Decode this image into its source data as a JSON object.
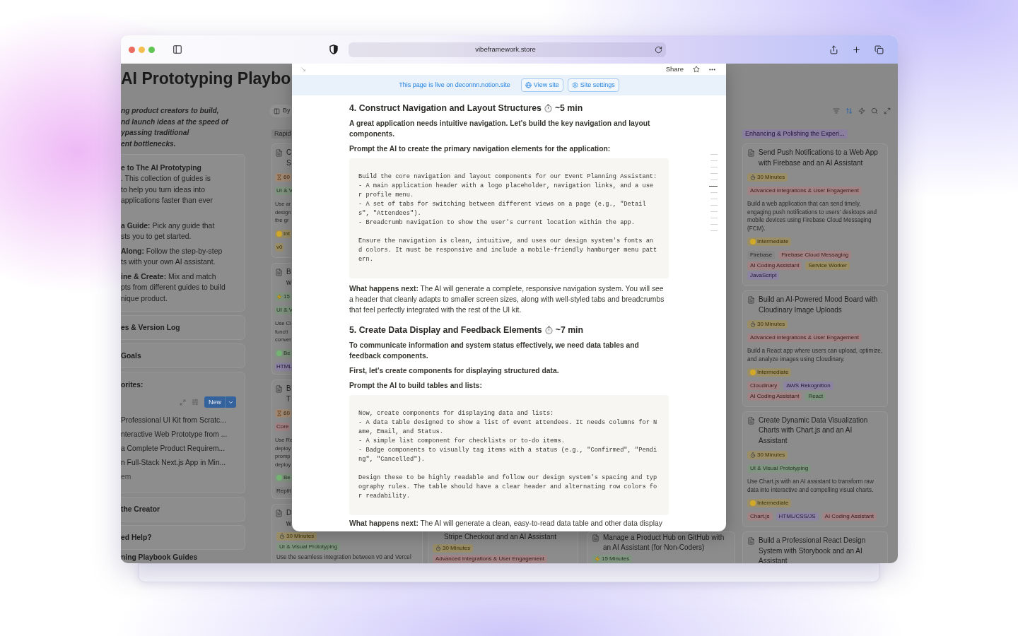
{
  "browser": {
    "address": "vibeframework.store"
  },
  "page": {
    "title": "AI Prototyping Playbo",
    "tagline": "ng product creators to build,\nnd launch ideas at the speed of\nypassing traditional\nent bottlenecks."
  },
  "sidebar": [
    {
      "kind": "callout",
      "paragraphs": [
        "**e to The AI Prototyping**\n. This collection of guides is\nto help you turn ideas into\napplications faster than ever",
        "**a Guide:** Pick any guide that\nsts you to get started.",
        "**Along:** Follow the step-by-step\nts with your own AI assistant.",
        "**ine & Create:** Mix and match\npts from different guides to build\nnique product."
      ]
    },
    {
      "kind": "toggle",
      "label": "es & Version Log"
    },
    {
      "kind": "toggle",
      "label": "Goals"
    },
    {
      "kind": "list",
      "label": "orites:",
      "button": "New",
      "items": [
        "Professional UI Kit from Scratc...",
        "nteractive Web Prototype from ...",
        "a Complete Product Requirem...",
        "n Full-Stack Next.js App in Min..."
      ],
      "add": "em"
    },
    {
      "kind": "toggle",
      "label": "the Creator"
    },
    {
      "kind": "toggle",
      "label": "ed Help?"
    },
    {
      "kind": "heading",
      "label": "ning Playbook Guides"
    }
  ],
  "board": {
    "view_button": "By",
    "tools": [
      {
        "kind": "filter",
        "on": false
      },
      {
        "kind": "sort",
        "on": true
      },
      {
        "kind": "automation",
        "on": false
      },
      {
        "kind": "search",
        "on": false
      },
      {
        "kind": "expand",
        "on": false
      }
    ],
    "columns": [
      {
        "kind": "strip",
        "group": {
          "label": "Rapid",
          "color": "#7f7f7f"
        },
        "cards": [
          {
            "kind": "card",
            "title": "C\nS",
            "rows": [
              {
                "kind": "tags",
                "tags": [
                  {
                    "label": "60",
                    "kind": "hourglass",
                    "color": "#a08a76"
                  }
                ]
              },
              {
                "kind": "tags",
                "tags": [
                  {
                    "label": "UI & V",
                    "kind": "plain",
                    "color": "#819381"
                  }
                ]
              },
              {
                "kind": "text",
                "text": "Use ar\ndesign\nthe gr"
              },
              {
                "kind": "tags",
                "tags": [
                  {
                    "label": "Int",
                    "kind": "dot",
                    "color": "#9a8e69"
                  }
                ]
              },
              {
                "kind": "tags",
                "tags": [
                  {
                    "label": "v0",
                    "kind": "plain",
                    "color": "#9a8e69"
                  }
                ]
              }
            ]
          },
          {
            "kind": "card",
            "title": "B\nw",
            "rows": [
              {
                "kind": "tags",
                "tags": [
                  {
                    "label": "15",
                    "kind": "bolt",
                    "color": "#819381"
                  }
                ]
              },
              {
                "kind": "tags",
                "tags": [
                  {
                    "label": "UI & V",
                    "kind": "plain",
                    "color": "#819381"
                  }
                ]
              },
              {
                "kind": "text",
                "text": "Use Cl\nfuncti\nconver"
              },
              {
                "kind": "tags",
                "tags": [
                  {
                    "label": "Be",
                    "kind": "dot",
                    "color": "#819381"
                  }
                ]
              },
              {
                "kind": "tags",
                "tags": [
                  {
                    "label": "HTML",
                    "kind": "plain",
                    "color": "#8d84a1"
                  }
                ]
              }
            ]
          },
          {
            "kind": "card",
            "title": "B\nT",
            "rows": [
              {
                "kind": "tags",
                "tags": [
                  {
                    "label": "60",
                    "kind": "hourglass",
                    "color": "#a08a76"
                  }
                ]
              },
              {
                "kind": "tags",
                "tags": [
                  {
                    "label": "Core",
                    "kind": "plain",
                    "color": "#a08384"
                  }
                ]
              },
              {
                "kind": "text",
                "text": "Use Re\ndeploy\npromp\ndeploy"
              },
              {
                "kind": "tags",
                "tags": [
                  {
                    "label": "Be",
                    "kind": "dot",
                    "color": "#819381"
                  }
                ]
              },
              {
                "kind": "tags",
                "tags": [
                  {
                    "label": "Replit",
                    "kind": "plain",
                    "color": "#868686"
                  }
                ]
              }
            ]
          },
          {
            "kind": "card",
            "title": "D\nw"
          }
        ],
        "continued": {
          "kind": "continued",
          "rows": [
            {
              "kind": "tags",
              "tags": [
                {
                  "label": "30 Minutes",
                  "kind": "timer",
                  "color": "#9a8e69"
                }
              ]
            },
            {
              "kind": "tags",
              "tags": [
                {
                  "label": "UI & Visual Prototyping",
                  "kind": "plain",
                  "color": "#819381"
                }
              ]
            },
            {
              "kind": "text",
              "text": "Use the seamless integration between v0 and Vercel"
            }
          ]
        }
      },
      {
        "kind": "bottom",
        "card": {
          "kind": "continued",
          "title": "Stripe Checkout and an AI Assistant",
          "rows": [
            {
              "kind": "tags",
              "tags": [
                {
                  "label": "30 Minutes",
                  "kind": "timer",
                  "color": "#9a8e69"
                }
              ]
            },
            {
              "kind": "tags",
              "tags": [
                {
                  "label": "Advanced Integrations & User Engagement",
                  "kind": "plain",
                  "color": "#a08384"
                }
              ]
            }
          ]
        }
      },
      {
        "kind": "bottom",
        "card": {
          "kind": "card",
          "title": "Manage a Product Hub on GitHub with an AI Assistant (for Non-Coders)",
          "rows": [
            {
              "kind": "tags",
              "tags": [
                {
                  "label": "15 Minutes",
                  "kind": "bolt",
                  "color": "#819381"
                }
              ]
            }
          ]
        }
      },
      {
        "kind": "full",
        "group": {
          "label": "Enhancing & Polishing the Experi...",
          "color": "#8b7fa0"
        },
        "cards": [
          {
            "kind": "card",
            "title": "Send Push Notifications to a Web App with Firebase and an AI Assistant",
            "rows": [
              {
                "kind": "tags",
                "tags": [
                  {
                    "label": "30 Minutes",
                    "kind": "timer",
                    "color": "#9a8e69"
                  }
                ]
              },
              {
                "kind": "tags",
                "tags": [
                  {
                    "label": "Advanced Integrations & User Engagement",
                    "kind": "plain",
                    "color": "#a08384"
                  }
                ]
              },
              {
                "kind": "text",
                "text": "Build a web application that can send timely, engaging push notifications to users' desktops and mobile devices using Firebase Cloud Messaging (FCM)."
              },
              {
                "kind": "tags",
                "tags": [
                  {
                    "label": "Intermediate",
                    "kind": "dot",
                    "color": "#9a8e69"
                  }
                ]
              },
              {
                "kind": "tags",
                "tags": [
                  {
                    "label": "Firebase",
                    "kind": "plain",
                    "color": "#868686"
                  },
                  {
                    "label": "Firebase Cloud Messaging",
                    "kind": "plain",
                    "color": "#a08384"
                  },
                  {
                    "label": "AI Coding Assistant",
                    "kind": "plain",
                    "color": "#a08384"
                  },
                  {
                    "label": "Service Worker",
                    "kind": "plain",
                    "color": "#9a8e69"
                  },
                  {
                    "label": "JavaScript",
                    "kind": "plain",
                    "color": "#8d84a1"
                  }
                ]
              }
            ]
          },
          {
            "kind": "card",
            "title": "Build an AI-Powered Mood Board with Cloudinary Image Uploads",
            "rows": [
              {
                "kind": "tags",
                "tags": [
                  {
                    "label": "30 Minutes",
                    "kind": "timer",
                    "color": "#9a8e69"
                  }
                ]
              },
              {
                "kind": "tags",
                "tags": [
                  {
                    "label": "Advanced Integrations & User Engagement",
                    "kind": "plain",
                    "color": "#a08384"
                  }
                ]
              },
              {
                "kind": "text",
                "text": "Build a React app where users can upload, optimize, and analyze images using Cloudinary."
              },
              {
                "kind": "tags",
                "tags": [
                  {
                    "label": "Intermediate",
                    "kind": "dot",
                    "color": "#9a8e69"
                  }
                ]
              },
              {
                "kind": "tags",
                "tags": [
                  {
                    "label": "Cloudinary",
                    "kind": "plain",
                    "color": "#a08384"
                  },
                  {
                    "label": "AWS Rekognition",
                    "kind": "plain",
                    "color": "#8d84a1"
                  },
                  {
                    "label": "AI Coding Assistant",
                    "kind": "plain",
                    "color": "#a08384"
                  },
                  {
                    "label": "React",
                    "kind": "plain",
                    "color": "#819381"
                  }
                ]
              }
            ]
          },
          {
            "kind": "card",
            "title": "Create Dynamic Data Visualization Charts with Chart.js and an AI Assistant",
            "rows": [
              {
                "kind": "tags",
                "tags": [
                  {
                    "label": "30 Minutes",
                    "kind": "timer",
                    "color": "#9a8e69"
                  }
                ]
              },
              {
                "kind": "tags",
                "tags": [
                  {
                    "label": "UI & Visual Prototyping",
                    "kind": "plain",
                    "color": "#819381"
                  }
                ]
              },
              {
                "kind": "text",
                "text": "Use Chart.js with an AI assistant to transform raw data into interactive and compelling visual charts."
              },
              {
                "kind": "tags",
                "tags": [
                  {
                    "label": "Intermediate",
                    "kind": "dot",
                    "color": "#9a8e69"
                  }
                ]
              },
              {
                "kind": "tags",
                "tags": [
                  {
                    "label": "Chart.js",
                    "kind": "plain",
                    "color": "#a08384"
                  },
                  {
                    "label": "HTML/CSS/JS",
                    "kind": "plain",
                    "color": "#8d84a1"
                  },
                  {
                    "label": "AI Coding Assistant",
                    "kind": "plain",
                    "color": "#a08384"
                  }
                ]
              }
            ]
          },
          {
            "kind": "card",
            "title": "Build a Professional React Design System with Storybook and an AI Assistant"
          }
        ]
      }
    ]
  },
  "modal": {
    "share": "Share",
    "banner": {
      "text": "This page is live on deconnn.notion.site",
      "buttons": [
        {
          "label": "View site",
          "kind": "globe"
        },
        {
          "label": "Site settings",
          "kind": "gear"
        }
      ]
    },
    "blocks": [
      {
        "kind": "heading",
        "title": "4. Construct Navigation and Layout Structures",
        "duration": "~5 min"
      },
      {
        "kind": "bold",
        "text": "A great application needs intuitive navigation. Let's build the key navigation and layout components."
      },
      {
        "kind": "bold",
        "text": "Prompt the AI to create the primary navigation elements for the application:"
      },
      {
        "kind": "code",
        "text": "Build the core navigation and layout components for our Event Planning Assistant:\n- A main application header with a logo placeholder, navigation links, and a use\nr profile menu.\n- A set of tabs for switching between different views on a page (e.g., \"Detail\ns\", \"Attendees\").\n- Breadcrumb navigation to show the user's current location within the app.\n\nEnsure the navigation is clean, intuitive, and uses our design system's fonts an\nd colors. It must be responsive and include a mobile-friendly hamburger menu patt\nern."
      },
      {
        "kind": "text",
        "text": "**What happens next:** The AI will generate a complete, responsive navigation system. You will see a header that cleanly adapts to smaller screen sizes, along with well-styled tabs and breadcrumbs that feel perfectly integrated with the rest of the UI kit."
      },
      {
        "kind": "heading",
        "title": "5. Create Data Display and Feedback Elements",
        "duration": "~7 min"
      },
      {
        "kind": "bold",
        "text": "To communicate information and system status effectively, we need data tables and feedback components."
      },
      {
        "kind": "bold",
        "text": "First, let's create components for displaying structured data."
      },
      {
        "kind": "bold",
        "text": "Prompt the AI to build tables and lists:"
      },
      {
        "kind": "code",
        "text": "Now, create components for displaying data and lists:\n- A data table designed to show a list of event attendees. It needs columns for N\name, Email, and Status.\n- A simple list component for checklists or to-do items.\n- Badge components to visually tag items with a status (e.g., \"Confirmed\", \"Pendi\nng\", \"Cancelled\").\n\nDesign these to be highly readable and follow our design system's spacing and typ\nography rules. The table should have a clear header and alternating row colors fo\nr readability."
      },
      {
        "kind": "text",
        "text": "**What happens next:** The AI will generate a clean, easy-to-read data table and other data display"
      }
    ]
  }
}
